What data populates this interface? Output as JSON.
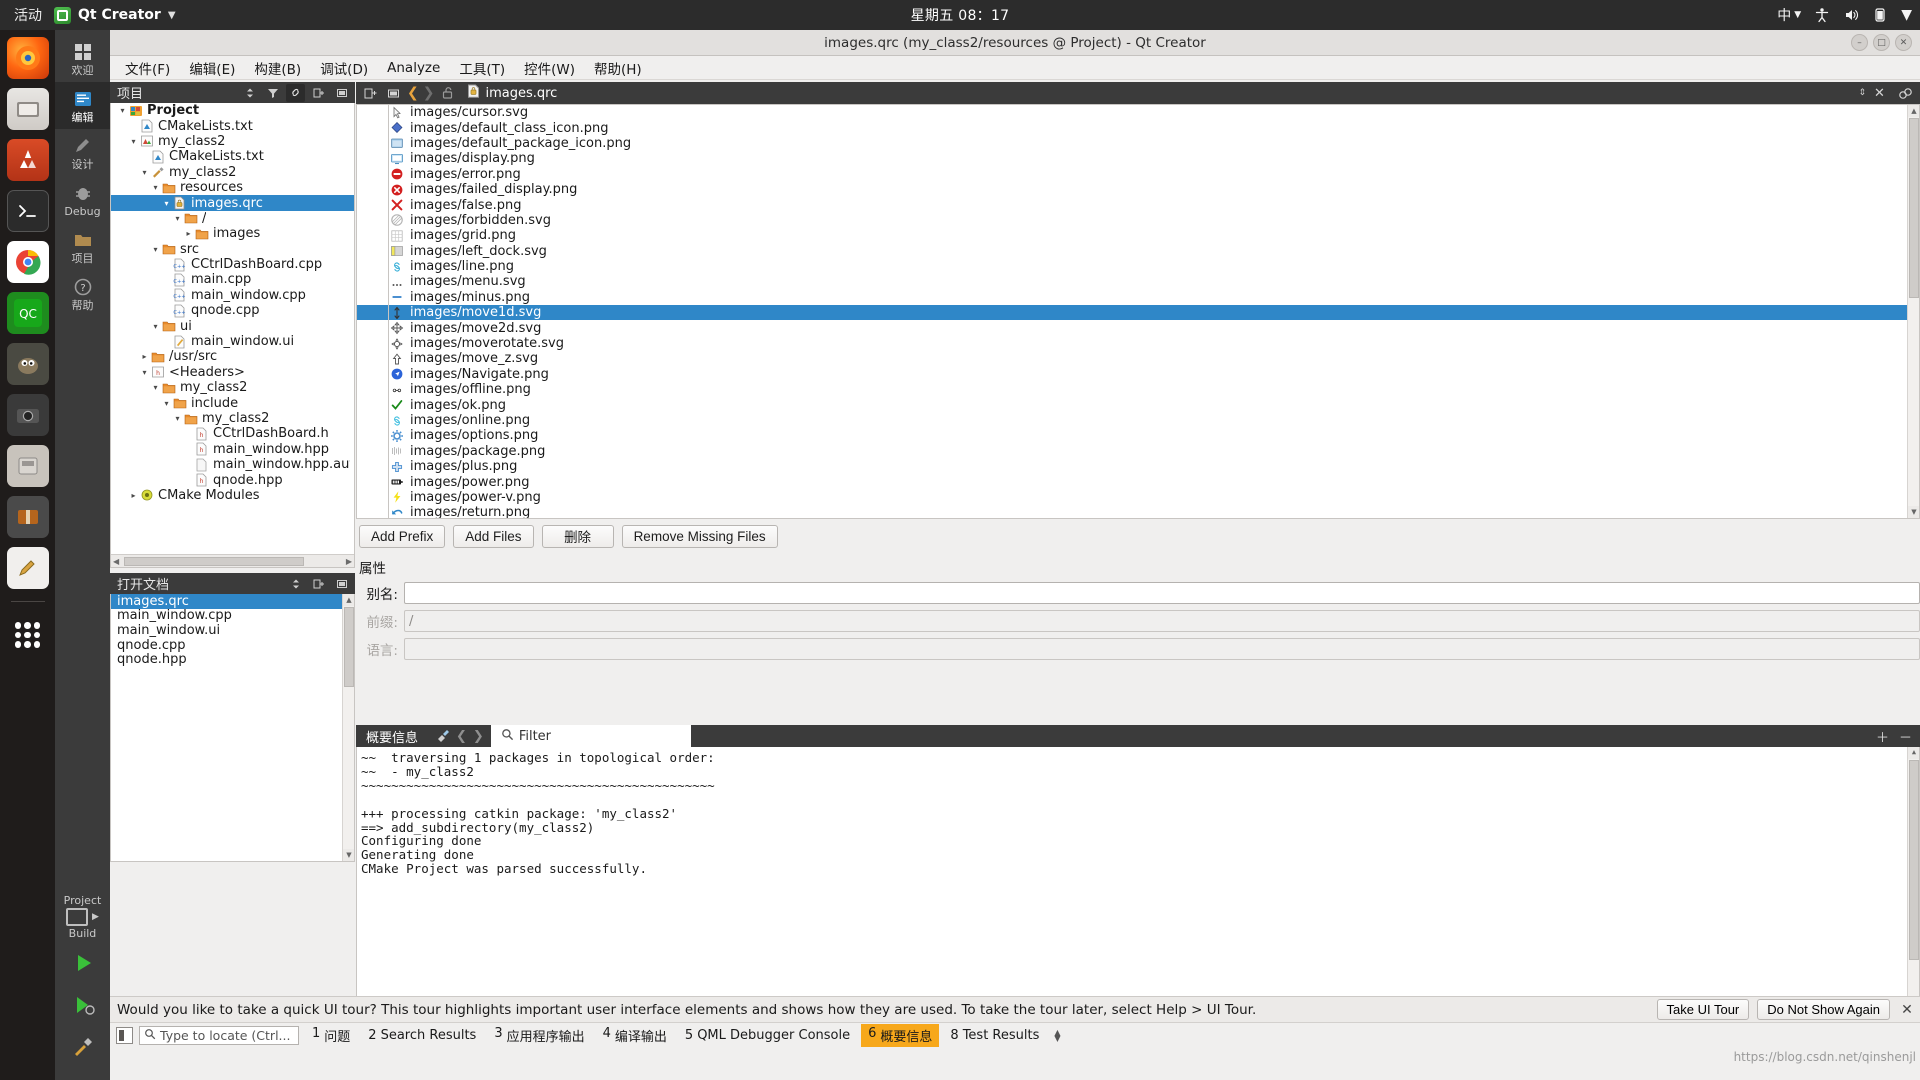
{
  "desktop": {
    "activities": "活动",
    "app_name": "Qt Creator",
    "clock": "星期五 08：17",
    "input_method": "中",
    "dock_items": [
      {
        "name": "firefox",
        "label": "Firefox"
      },
      {
        "name": "files",
        "label": "Files"
      },
      {
        "name": "software",
        "label": "Ubuntu Software"
      },
      {
        "name": "terminal",
        "label": "Terminal"
      },
      {
        "name": "chrome",
        "label": "Google Chrome"
      },
      {
        "name": "qtcreator",
        "label": "Qt Creator"
      },
      {
        "name": "gimp",
        "label": "GIMP"
      },
      {
        "name": "camera",
        "label": "Camera"
      },
      {
        "name": "disks",
        "label": "Disks"
      },
      {
        "name": "archive",
        "label": "Archive Manager"
      },
      {
        "name": "paint",
        "label": "Paint"
      },
      {
        "name": "show-apps",
        "label": "Show Applications"
      }
    ]
  },
  "window": {
    "title": "images.qrc (my_class2/resources @ Project) - Qt Creator"
  },
  "menubar": [
    {
      "label": "文件(F)"
    },
    {
      "label": "编辑(E)"
    },
    {
      "label": "构建(B)"
    },
    {
      "label": "调试(D)"
    },
    {
      "label": "Analyze"
    },
    {
      "label": "工具(T)"
    },
    {
      "label": "控件(W)"
    },
    {
      "label": "帮助(H)"
    }
  ],
  "modebar": {
    "modes": [
      {
        "label": "欢迎",
        "icon": "welcome-icon",
        "active": false
      },
      {
        "label": "编辑",
        "icon": "edit-icon",
        "active": true
      },
      {
        "label": "设计",
        "icon": "design-icon",
        "active": false
      },
      {
        "label": "Debug",
        "icon": "debug-icon",
        "active": false
      },
      {
        "label": "项目",
        "icon": "projects-icon",
        "active": false
      },
      {
        "label": "帮助",
        "icon": "help-icon",
        "active": false
      }
    ],
    "kit_project": "Project",
    "kit_build": "Build"
  },
  "project_pane": {
    "title": "项目",
    "tree": [
      {
        "depth": 0,
        "twist": "▾",
        "icon": "project-icon",
        "label": "Project",
        "bold": true
      },
      {
        "depth": 1,
        "twist": "",
        "icon": "cmake-icon",
        "label": "CMakeLists.txt"
      },
      {
        "depth": 1,
        "twist": "▾",
        "icon": "cmake-project-icon",
        "label": "my_class2"
      },
      {
        "depth": 2,
        "twist": "",
        "icon": "cmake-icon",
        "label": "CMakeLists.txt"
      },
      {
        "depth": 2,
        "twist": "▾",
        "icon": "build-target-icon",
        "label": "my_class2"
      },
      {
        "depth": 3,
        "twist": "▾",
        "icon": "folder-icon",
        "label": "resources"
      },
      {
        "depth": 4,
        "twist": "▾",
        "icon": "qrc-icon",
        "label": "images.qrc",
        "selected": true
      },
      {
        "depth": 5,
        "twist": "▾",
        "icon": "folder-icon",
        "label": "/"
      },
      {
        "depth": 6,
        "twist": "▸",
        "icon": "folder-icon",
        "label": "images"
      },
      {
        "depth": 3,
        "twist": "▾",
        "icon": "folder-icon",
        "label": "src"
      },
      {
        "depth": 4,
        "twist": "",
        "icon": "cpp-icon",
        "label": "CCtrlDashBoard.cpp"
      },
      {
        "depth": 4,
        "twist": "",
        "icon": "cpp-icon",
        "label": "main.cpp"
      },
      {
        "depth": 4,
        "twist": "",
        "icon": "cpp-icon",
        "label": "main_window.cpp"
      },
      {
        "depth": 4,
        "twist": "",
        "icon": "cpp-icon",
        "label": "qnode.cpp"
      },
      {
        "depth": 3,
        "twist": "▾",
        "icon": "folder-icon",
        "label": "ui"
      },
      {
        "depth": 4,
        "twist": "",
        "icon": "ui-icon",
        "label": "main_window.ui"
      },
      {
        "depth": 2,
        "twist": "▸",
        "icon": "folder-icon",
        "label": "/usr/src"
      },
      {
        "depth": 2,
        "twist": "▾",
        "icon": "headers-icon",
        "label": "<Headers>"
      },
      {
        "depth": 3,
        "twist": "▾",
        "icon": "folder-icon",
        "label": "my_class2"
      },
      {
        "depth": 4,
        "twist": "▾",
        "icon": "folder-icon",
        "label": "include"
      },
      {
        "depth": 5,
        "twist": "▾",
        "icon": "folder-icon",
        "label": "my_class2"
      },
      {
        "depth": 6,
        "twist": "",
        "icon": "h-icon",
        "label": "CCtrlDashBoard.h"
      },
      {
        "depth": 6,
        "twist": "",
        "icon": "h-icon",
        "label": "main_window.hpp"
      },
      {
        "depth": 6,
        "twist": "",
        "icon": "plain-file-icon",
        "label": "main_window.hpp.autos"
      },
      {
        "depth": 6,
        "twist": "",
        "icon": "h-icon",
        "label": "qnode.hpp"
      },
      {
        "depth": 1,
        "twist": "▸",
        "icon": "cmake-modules-icon",
        "label": "CMake Modules"
      }
    ]
  },
  "open_documents": {
    "title": "打开文档",
    "items": [
      {
        "label": "images.qrc",
        "selected": true
      },
      {
        "label": "main_window.cpp",
        "selected": false
      },
      {
        "label": "main_window.ui",
        "selected": false
      },
      {
        "label": "qnode.cpp",
        "selected": false
      },
      {
        "label": "qnode.hpp",
        "selected": false
      }
    ]
  },
  "editor": {
    "current_file": "images.qrc",
    "files": [
      {
        "icon": "cursor-icon",
        "label": "images/cursor.svg"
      },
      {
        "icon": "class-icon",
        "label": "images/default_class_icon.png"
      },
      {
        "icon": "package-folder-icon",
        "label": "images/default_package_icon.png"
      },
      {
        "icon": "display-icon",
        "label": "images/display.png"
      },
      {
        "icon": "error-icon",
        "label": "images/error.png"
      },
      {
        "icon": "failed-display-icon",
        "label": "images/failed_display.png"
      },
      {
        "icon": "false-icon",
        "label": "images/false.png"
      },
      {
        "icon": "forbidden-icon",
        "label": "images/forbidden.svg"
      },
      {
        "icon": "grid-icon",
        "label": "images/grid.png"
      },
      {
        "icon": "left-dock-icon",
        "label": "images/left_dock.svg"
      },
      {
        "icon": "line-icon",
        "label": "images/line.png"
      },
      {
        "icon": "menu-icon",
        "label": "images/menu.svg"
      },
      {
        "icon": "minus-icon",
        "label": "images/minus.png"
      },
      {
        "icon": "move1d-icon",
        "label": "images/move1d.svg",
        "selected": true
      },
      {
        "icon": "move2d-icon",
        "label": "images/move2d.svg"
      },
      {
        "icon": "moverotate-icon",
        "label": "images/moverotate.svg"
      },
      {
        "icon": "move-z-icon",
        "label": "images/move_z.svg"
      },
      {
        "icon": "navigate-icon",
        "label": "images/Navigate.png"
      },
      {
        "icon": "offline-icon",
        "label": "images/offline.png"
      },
      {
        "icon": "ok-icon",
        "label": "images/ok.png"
      },
      {
        "icon": "online-icon",
        "label": "images/online.png"
      },
      {
        "icon": "options-icon",
        "label": "images/options.png"
      },
      {
        "icon": "package-icon",
        "label": "images/package.png"
      },
      {
        "icon": "plus-icon",
        "label": "images/plus.png"
      },
      {
        "icon": "power-icon",
        "label": "images/power.png"
      },
      {
        "icon": "power-v-icon",
        "label": "images/power-v.png"
      },
      {
        "icon": "return-icon",
        "label": "images/return.png"
      }
    ]
  },
  "resource_buttons": {
    "add_prefix": "Add Prefix",
    "add_files": "Add Files",
    "remove": "删除",
    "remove_missing": "Remove Missing Files"
  },
  "properties": {
    "title": "属性",
    "alias_label": "别名:",
    "alias_value": "",
    "prefix_label": "前缀:",
    "prefix_value": "/",
    "language_label": "语言:",
    "language_value": ""
  },
  "output_pane": {
    "tab_label": "概要信息",
    "filter_placeholder": "Filter",
    "lines": [
      "~~  traversing 1 packages in topological order:",
      "~~  - my_class2",
      "~~~~~~~~~~~~~~~~~~~~~~~~~~~~~~~~~~~~~~~~~~~~~~~",
      "",
      "+++ processing catkin package: 'my_class2'",
      "==> add_subdirectory(my_class2)",
      "Configuring done",
      "Generating done",
      "CMake Project was parsed successfully."
    ]
  },
  "ui_tour": {
    "message": "Would you like to take a quick UI tour? This tour highlights important user interface elements and shows how they are used. To take the tour later, select Help > UI Tour.",
    "take_tour": "Take UI Tour",
    "dont_show": "Do Not Show Again",
    "close": "✕"
  },
  "status_bar": {
    "locate_placeholder": "Type to locate (Ctrl...",
    "tabs": [
      {
        "num": "1",
        "label": "问题",
        "selected": false
      },
      {
        "num": "2",
        "label": "Search Results",
        "selected": false
      },
      {
        "num": "3",
        "label": "应用程序输出",
        "selected": false
      },
      {
        "num": "4",
        "label": "编译输出",
        "selected": false
      },
      {
        "num": "5",
        "label": "QML Debugger Console",
        "selected": false
      },
      {
        "num": "6",
        "label": "概要信息",
        "selected": true
      },
      {
        "num": "8",
        "label": "Test Results",
        "selected": false
      }
    ]
  },
  "watermark": "https://blog.csdn.net/qinshenjl",
  "colors": {
    "selection": "#2f87c8",
    "panel_dark": "#3b3b3b",
    "accent_orange": "#f7a81b"
  }
}
